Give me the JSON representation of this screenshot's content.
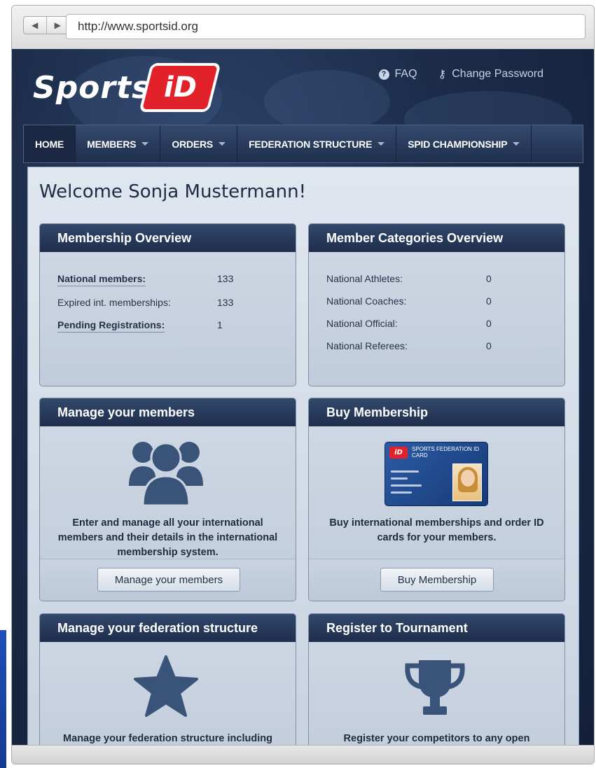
{
  "browser": {
    "url": "http://www.sportsid.org",
    "back_glyph": "◀",
    "forward_glyph": "▶"
  },
  "site": {
    "logo_text": "Sports",
    "logo_badge": "iD",
    "top_links": {
      "faq": "FAQ",
      "change_password": "Change Password"
    },
    "menu": [
      {
        "label": "HOME",
        "has_caret": false
      },
      {
        "label": "MEMBERS",
        "has_caret": true
      },
      {
        "label": "ORDERS",
        "has_caret": true
      },
      {
        "label": "FEDERATION STRUCTURE",
        "has_caret": true
      },
      {
        "label": "SPID CHAMPIONSHIP",
        "has_caret": true
      }
    ],
    "welcome": "Welcome Sonja Mustermann!"
  },
  "panels": {
    "membership_overview": {
      "title": "Membership Overview",
      "rows": [
        {
          "label": "National members:",
          "value": "133"
        },
        {
          "label": "Expired int. memberships:",
          "value": "133"
        },
        {
          "label": "Pending Registrations:",
          "value": "1"
        }
      ]
    },
    "member_categories": {
      "title": "Member Categories Overview",
      "rows": [
        {
          "label": "National Athletes:",
          "value": "0"
        },
        {
          "label": "National Coaches:",
          "value": "0"
        },
        {
          "label": "National Official:",
          "value": "0"
        },
        {
          "label": "National Referees:",
          "value": "0"
        }
      ]
    },
    "manage_members": {
      "title": "Manage your members",
      "text": "Enter and manage all your international members and their details in the international membership system.",
      "button": "Manage your members"
    },
    "buy_membership": {
      "title": "Buy Membership",
      "text": "Buy international memberships and order ID cards for your members.",
      "button": "Buy Membership",
      "card_title": "SPORTS FEDERATION ID CARD",
      "card_logo": "iD"
    },
    "federation_structure": {
      "title": "Manage your federation structure",
      "text": "Manage your federation structure including"
    },
    "register_tournament": {
      "title": "Register to Tournament",
      "text": "Register your competitors to any open"
    }
  },
  "colors": {
    "menubar": "#1e2f4d",
    "panel_header": "#1e2e4b",
    "icon": "#3a5378",
    "logo_red": "#e2222a"
  }
}
